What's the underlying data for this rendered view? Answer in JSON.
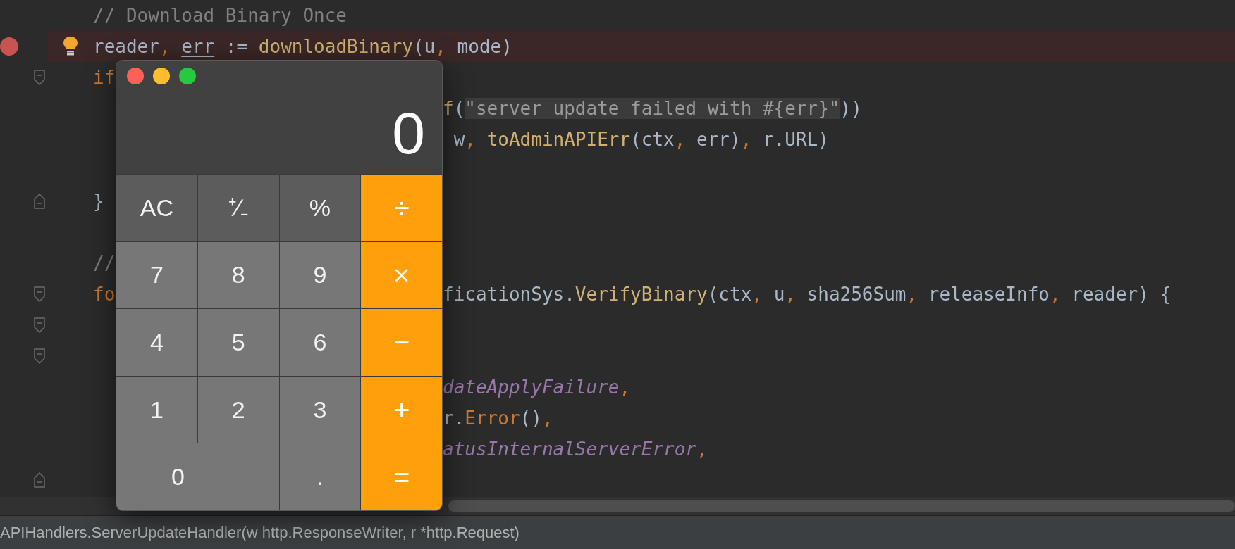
{
  "editor": {
    "lines": [
      {
        "kind": "code",
        "left": [
          {
            "t": "// Download Binary Once",
            "kind": "comment"
          }
        ]
      },
      {
        "kind": "code",
        "breakpoint": true,
        "bulb": true,
        "left": [
          {
            "t": "reader",
            "kind": "plain"
          },
          {
            "t": ", ",
            "kind": "punct"
          },
          {
            "t": "err",
            "kind": "underlined"
          },
          {
            "t": " := ",
            "kind": "plain"
          },
          {
            "t": "downloadBinary",
            "kind": "func"
          },
          {
            "t": "(u",
            "kind": "plain"
          },
          {
            "t": ", ",
            "kind": "punct"
          },
          {
            "t": "mode)",
            "kind": "plain"
          }
        ]
      },
      {
        "kind": "code",
        "fold_start": true,
        "left": [
          {
            "t": "if",
            "kind": "keyword"
          }
        ]
      },
      {
        "kind": "code",
        "right": [
          {
            "t": "f",
            "kind": "func"
          },
          {
            "t": "(",
            "kind": "plain"
          },
          {
            "t": "\"server update failed with #{err}\"",
            "kind": "string"
          },
          {
            "t": "))",
            "kind": "plain"
          }
        ]
      },
      {
        "kind": "code",
        "right": [
          {
            "t": " w",
            "kind": "plain"
          },
          {
            "t": ", ",
            "kind": "punct"
          },
          {
            "t": "toAdminAPIErr",
            "kind": "func"
          },
          {
            "t": "(ctx",
            "kind": "plain"
          },
          {
            "t": ", ",
            "kind": "punct"
          },
          {
            "t": "err)",
            "kind": "plain"
          },
          {
            "t": ", ",
            "kind": "punct"
          },
          {
            "t": "r.URL)",
            "kind": "plain"
          }
        ]
      },
      {
        "kind": "blank"
      },
      {
        "kind": "code",
        "fold_end": true,
        "left": [
          {
            "t": "}",
            "kind": "plain"
          }
        ]
      },
      {
        "kind": "blank"
      },
      {
        "kind": "code",
        "left": [
          {
            "t": "//",
            "kind": "comment"
          }
        ]
      },
      {
        "kind": "code",
        "fold_start": true,
        "left": [
          {
            "t": "fo",
            "kind": "keyword"
          }
        ],
        "right": [
          {
            "t": "ficationSys.",
            "kind": "plain"
          },
          {
            "t": "VerifyBinary",
            "kind": "func"
          },
          {
            "t": "(ctx",
            "kind": "plain"
          },
          {
            "t": ", ",
            "kind": "punct"
          },
          {
            "t": "u",
            "kind": "plain"
          },
          {
            "t": ", ",
            "kind": "punct"
          },
          {
            "t": "sha256Sum",
            "kind": "plain"
          },
          {
            "t": ", ",
            "kind": "punct"
          },
          {
            "t": "releaseInfo",
            "kind": "plain"
          },
          {
            "t": ", ",
            "kind": "punct"
          },
          {
            "t": "reader) {",
            "kind": "plain"
          }
        ]
      },
      {
        "kind": "code",
        "fold_start": true
      },
      {
        "kind": "code",
        "fold_start": true
      },
      {
        "kind": "code",
        "right": [
          {
            "t": "dateApplyFailure",
            "kind": "constant"
          },
          {
            "t": ",",
            "kind": "punct"
          }
        ]
      },
      {
        "kind": "code",
        "right": [
          {
            "t": "r.",
            "kind": "plain"
          },
          {
            "t": "Error",
            "kind": "method"
          },
          {
            "t": "()",
            "kind": "plain"
          },
          {
            "t": ",",
            "kind": "punct"
          }
        ]
      },
      {
        "kind": "code",
        "right": [
          {
            "t": "atusInternalServerError",
            "kind": "constant"
          },
          {
            "t": ",",
            "kind": "punct"
          }
        ]
      },
      {
        "kind": "code",
        "fold_end": true
      }
    ]
  },
  "calculator": {
    "display": "0",
    "keys": [
      {
        "label": "AC",
        "kind": "function"
      },
      {
        "label": "⁺∕₋",
        "kind": "function"
      },
      {
        "label": "%",
        "kind": "function"
      },
      {
        "label": "÷",
        "kind": "operator"
      },
      {
        "label": "7",
        "kind": "digit"
      },
      {
        "label": "8",
        "kind": "digit"
      },
      {
        "label": "9",
        "kind": "digit"
      },
      {
        "label": "×",
        "kind": "operator"
      },
      {
        "label": "4",
        "kind": "digit"
      },
      {
        "label": "5",
        "kind": "digit"
      },
      {
        "label": "6",
        "kind": "digit"
      },
      {
        "label": "−",
        "kind": "operator"
      },
      {
        "label": "1",
        "kind": "digit"
      },
      {
        "label": "2",
        "kind": "digit"
      },
      {
        "label": "3",
        "kind": "digit"
      },
      {
        "label": "+",
        "kind": "operator"
      },
      {
        "label": "0",
        "kind": "wide"
      },
      {
        "label": ".",
        "kind": "digit"
      },
      {
        "label": "=",
        "kind": "operator"
      }
    ]
  },
  "status_bar": {
    "text": "APIHandlers.ServerUpdateHandler(w http.ResponseWriter, r *http.Request)"
  }
}
